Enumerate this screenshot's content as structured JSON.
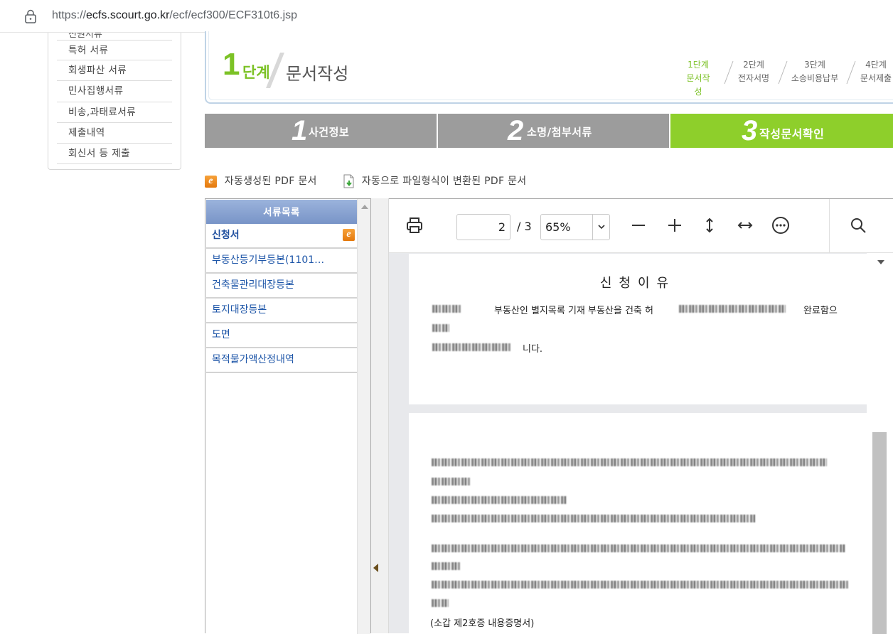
{
  "browser": {
    "url_prefix": "https://",
    "url_host": "ecfs.scourt.go.kr",
    "url_path": "/ecf/ecf300/ECF310t6.jsp"
  },
  "leftnav": {
    "cut_item": "전원서류",
    "items": [
      "특허 서류",
      "회생파산 서류",
      "민사집행서류",
      "비송,과태료서류",
      "제출내역",
      "회신서 등 제출"
    ]
  },
  "step": {
    "num": "1",
    "label": "단계",
    "title": "문서작성",
    "mini": [
      {
        "top": "1단계",
        "bottom": "문서작성"
      },
      {
        "top": "2단계",
        "bottom": "전자서명"
      },
      {
        "top": "3단계",
        "bottom": "소송비용납부"
      },
      {
        "top": "4단계",
        "bottom": "문서제출"
      }
    ]
  },
  "tabs": [
    {
      "num": "1",
      "label": "사건정보"
    },
    {
      "num": "2",
      "label": "소명/첨부서류"
    },
    {
      "num": "3",
      "label": "작성문서확인"
    }
  ],
  "legend": {
    "auto_pdf": "자동생성된 PDF 문서",
    "converted_pdf": "자동으로 파일형식이 변환된 PDF 문서"
  },
  "doclist": {
    "header": "서류목록",
    "items": [
      "신청서",
      "부동산등기부등본(1101…",
      "건축물관리대장등본",
      "토지대장등본",
      "도면",
      "목적물가액산정내역"
    ]
  },
  "viewer": {
    "page_current": "2",
    "page_total": "/ 3",
    "zoom": "65%",
    "page1_title": "신청이유",
    "page1_frag1": "부동산인 별지목록 기재 부동산을 건축 허",
    "page1_frag2": "완료함으",
    "page1_frag3": "니다.",
    "page2_footer": "(소갑 제2호증 내용증명서)"
  }
}
